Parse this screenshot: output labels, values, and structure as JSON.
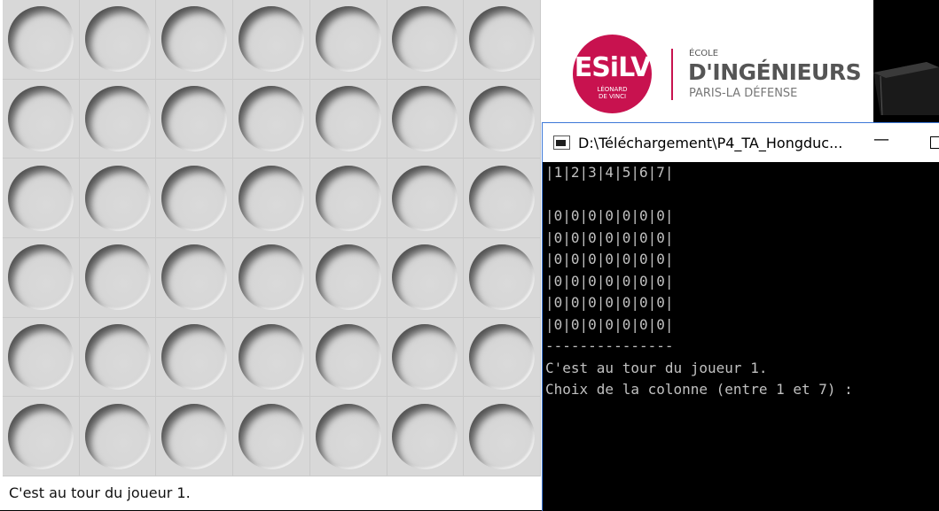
{
  "game": {
    "rows": 6,
    "cols": 7,
    "status": "C'est au tour du joueur 1."
  },
  "logo": {
    "mark": "ESiLV",
    "mark_sub": "LÉONARD\nDE VINCI",
    "line1": "ÉCOLE",
    "line2": "D'INGÉNIEURS",
    "line3": "PARIS-LA DÉFENSE",
    "brand_color": "#c8124f"
  },
  "console": {
    "title": "D:\\Téléchargement\\P4_TA_Hongduc...",
    "minimize": "—",
    "lines": [
      "|1|2|3|4|5|6|7|",
      "",
      "|0|0|0|0|0|0|0|",
      "|0|0|0|0|0|0|0|",
      "|0|0|0|0|0|0|0|",
      "|0|0|0|0|0|0|0|",
      "|0|0|0|0|0|0|0|",
      "|0|0|0|0|0|0|0|",
      "---------------",
      "C'est au tour du joueur 1.",
      "Choix de la colonne (entre 1 et 7) :"
    ]
  }
}
